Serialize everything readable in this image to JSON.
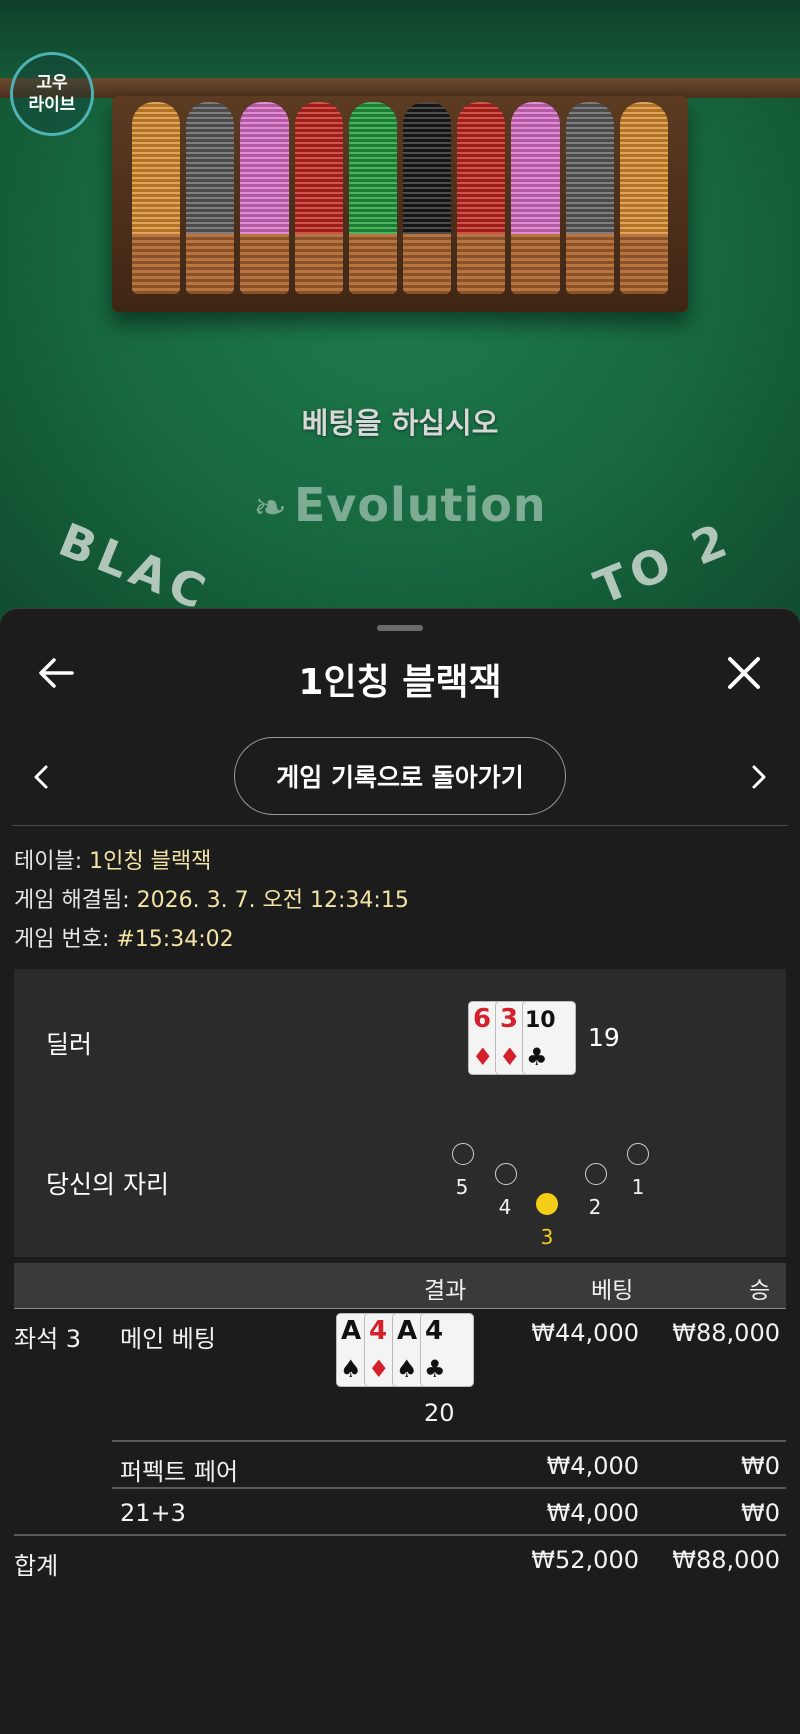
{
  "game_view": {
    "brand_logo_line1": "고우",
    "brand_logo_line2": "라이브",
    "betting_message": "베팅을 하십시오",
    "provider_logo": "Evolution",
    "table_text_left": "BLAC",
    "table_text_right": "TO 2",
    "chip_colors": [
      "#d98c2e",
      "#5a5a5a",
      "#d96fc8",
      "#c0241c",
      "#1f9a3a",
      "#1a1a1a",
      "#c0241c",
      "#d96fc8",
      "#5a5a5a",
      "#d98c2e"
    ]
  },
  "sheet": {
    "title": "1인칭 블랙잭",
    "return_button": "게임 기록으로 돌아가기",
    "info": {
      "table_label": "테이블:",
      "table_value": "1인칭 블랙잭",
      "resolved_label": "게임 해결됨:",
      "resolved_value": "2026. 3. 7. 오전 12:34:15",
      "game_no_label": "게임 번호:",
      "game_no_value": "#15:34:02"
    },
    "result": {
      "dealer_label": "딜러",
      "dealer_cards": [
        {
          "rank": "6",
          "suit": "♦",
          "color": "red"
        },
        {
          "rank": "3",
          "suit": "♦",
          "color": "red"
        },
        {
          "rank": "10",
          "suit": "♣",
          "color": "black"
        }
      ],
      "dealer_total": "19",
      "seat_label": "당신의 자리",
      "seats": [
        "5",
        "4",
        "3",
        "2",
        "1"
      ],
      "active_seat": "3"
    },
    "bets": {
      "headers": {
        "result": "결과",
        "bet": "베팅",
        "win": "승"
      },
      "seat_label": "좌석 3",
      "main": {
        "label": "메인 베팅",
        "cards": [
          {
            "rank": "A",
            "suit": "♠",
            "color": "black"
          },
          {
            "rank": "4",
            "suit": "♦",
            "color": "red"
          },
          {
            "rank": "A",
            "suit": "♠",
            "color": "black"
          },
          {
            "rank": "4",
            "suit": "♣",
            "color": "black"
          }
        ],
        "total": "20",
        "bet": "₩44,000",
        "win": "₩88,000"
      },
      "perfect_pair": {
        "label": "퍼펙트 페어",
        "bet": "₩4,000",
        "win": "₩0"
      },
      "side_21_3": {
        "label": "21+3",
        "bet": "₩4,000",
        "win": "₩0"
      },
      "total": {
        "label": "합계",
        "bet": "₩52,000",
        "win": "₩88,000"
      }
    }
  }
}
